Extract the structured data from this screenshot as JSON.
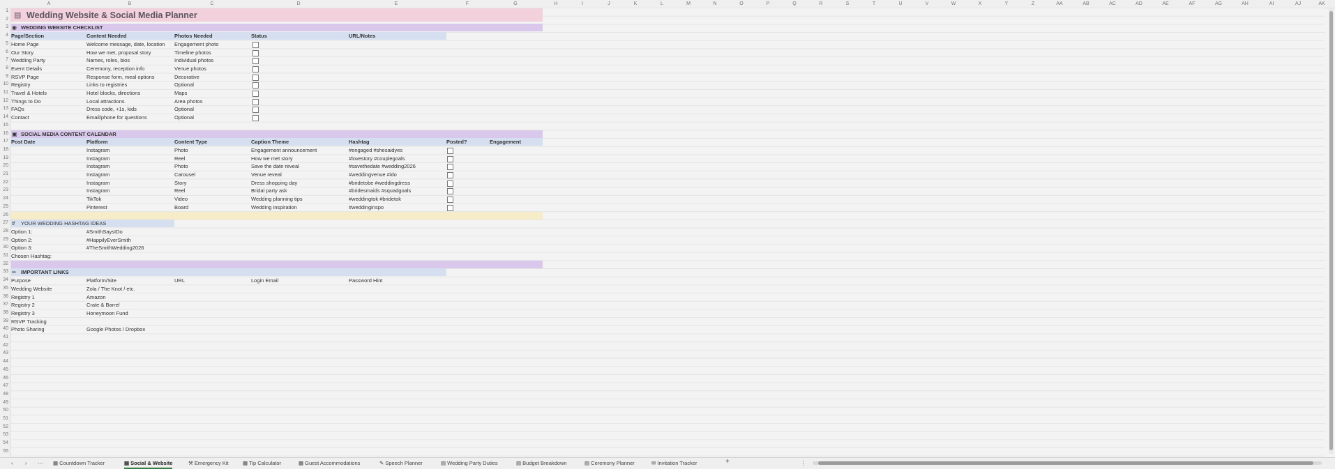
{
  "columns": [
    "A",
    "B",
    "C",
    "D",
    "E",
    "F",
    "G",
    "H",
    "I",
    "J",
    "K",
    "L",
    "M",
    "N",
    "O",
    "P",
    "Q",
    "R",
    "S",
    "T",
    "U",
    "V",
    "W",
    "X",
    "Y",
    "Z",
    "AA",
    "AB",
    "AC",
    "AD",
    "AE",
    "AF",
    "AG",
    "AH",
    "AI",
    "AJ",
    "AK"
  ],
  "title": "Wedding Website & Social Media Planner",
  "website": {
    "section": "WEDDING WEBSITE CHECKLIST",
    "headers": [
      "Page/Section",
      "Content Needed",
      "Photos Needed",
      "Status",
      "URL/Notes"
    ],
    "rows": [
      [
        "Home Page",
        "Welcome message, date, location",
        "Engagement photo"
      ],
      [
        "Our Story",
        "How we met, proposal story",
        "Timeline photos"
      ],
      [
        "Wedding Party",
        "Names, roles, bios",
        "Individual photos"
      ],
      [
        "Event Details",
        "Ceremony, reception info",
        "Venue photos"
      ],
      [
        "RSVP Page",
        "Response form, meal options",
        "Decorative"
      ],
      [
        "Registry",
        "Links to registries",
        "Optional"
      ],
      [
        "Travel & Hotels",
        "Hotel blocks, directions",
        "Maps"
      ],
      [
        "Things to Do",
        "Local attractions",
        "Area photos"
      ],
      [
        "FAQs",
        "Dress code, +1s, kids",
        "Optional"
      ],
      [
        "Contact",
        "Email/phone for questions",
        "Optional"
      ]
    ]
  },
  "social": {
    "section": "SOCIAL MEDIA CONTENT CALENDAR",
    "headers": [
      "Post Date",
      "Platform",
      "Content Type",
      "Caption Theme",
      "Hashtag",
      "Posted?",
      "Engagement"
    ],
    "rows": [
      [
        "Instagram",
        "Photo",
        "Engagement announcement",
        "#engaged #shesaidyes"
      ],
      [
        "Instagram",
        "Reel",
        "How we met story",
        "#lovestory #couplegoals"
      ],
      [
        "Instagram",
        "Photo",
        "Save the date reveal",
        "#savethedate #wedding2026"
      ],
      [
        "Instagram",
        "Carousel",
        "Venue reveal",
        "#weddingvenue #ido"
      ],
      [
        "Instagram",
        "Story",
        "Dress shopping day",
        "#bridetobe #weddingdress"
      ],
      [
        "Instagram",
        "Reel",
        "Bridal party ask",
        "#bridesmaids #squadgoals"
      ],
      [
        "TikTok",
        "Video",
        "Wedding planning tips",
        "#weddingtok #bridetok"
      ],
      [
        "Pinterest",
        "Board",
        "Wedding inspiration",
        "#weddinginspo"
      ]
    ]
  },
  "hashtags": {
    "section": "YOUR WEDDING HASHTAG IDEAS",
    "rows": [
      [
        "Option 1:",
        "#SmithSaysIDo"
      ],
      [
        "Option 2:",
        "#HappilyEverSmith"
      ],
      [
        "Option 3:",
        "#TheSmithWedding2026"
      ],
      [
        "Chosen Hashtag:",
        ""
      ]
    ]
  },
  "links": {
    "section": "IMPORTANT LINKS",
    "headers": [
      "Purpose",
      "Platform/Site",
      "URL",
      "Login Email",
      "Password Hint"
    ],
    "rows": [
      [
        "Wedding Website",
        "Zola / The Knot / etc."
      ],
      [
        "Registry 1",
        "Amazon"
      ],
      [
        "Registry 2",
        "Crate & Barrel"
      ],
      [
        "Registry 3",
        "Honeymoon Fund"
      ],
      [
        "RSVP Tracking",
        ""
      ],
      [
        "Photo Sharing",
        "Google Photos / Dropbox"
      ]
    ]
  },
  "tabs": [
    "Countdown Tracker",
    "Social & Website",
    "Emergency Kit",
    "Tip Calculator",
    "Guest Accommodations",
    "Speech Planner",
    "Wedding Party Duties",
    "Budget Breakdown",
    "Ceremony Planner",
    "Invitation Tracker"
  ],
  "active_tab": "Social & Website",
  "icons": {
    "title": "clipboard-icon",
    "website": "globe-icon",
    "social": "camera-icon",
    "hashtag": "hash-icon",
    "links": "link-icon"
  }
}
